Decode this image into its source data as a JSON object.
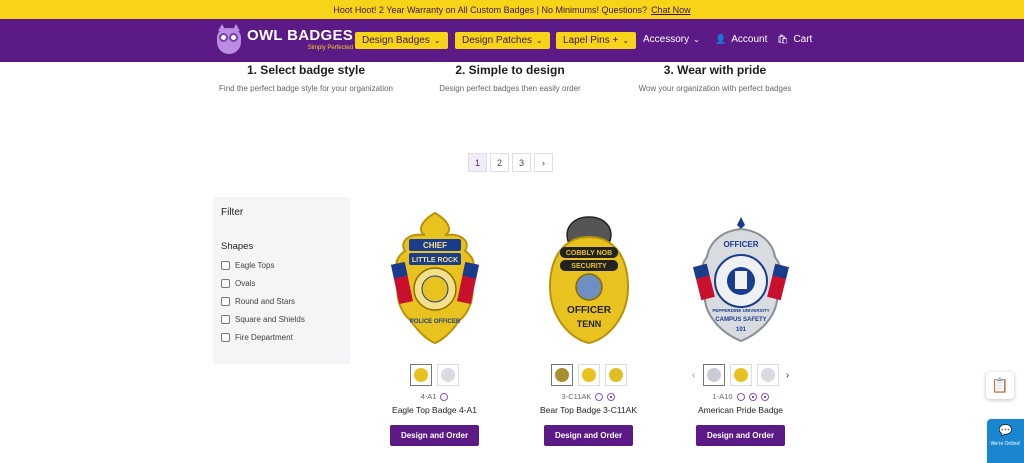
{
  "announcement": {
    "text": "Hoot Hoot! 2 Year Warranty on All Custom Badges | No Minimums!  Questions?",
    "link": "Chat Now"
  },
  "header": {
    "brand": "OWL BADGES",
    "tagline": "Simply Perfected",
    "nav_primary": [
      {
        "label": "Design Badges",
        "icon": "chevron-down-icon"
      },
      {
        "label": "Design Patches",
        "icon": "chevron-down-icon"
      },
      {
        "label": "Lapel Pins +",
        "icon": "chevron-down-icon"
      }
    ],
    "accessory": "Accessory",
    "account": "Account",
    "cart": "Cart"
  },
  "steps": [
    {
      "title": "1. Select badge style",
      "desc": "Find the perfect badge style for your organization"
    },
    {
      "title": "2. Simple to design",
      "desc": "Design perfect badges then easily order"
    },
    {
      "title": "3. Wear with pride",
      "desc": "Wow your organization with perfect badges"
    }
  ],
  "pagination": {
    "pages": [
      "1",
      "2",
      "3"
    ],
    "next": "›",
    "current": "1"
  },
  "filter": {
    "title": "Filter",
    "group": "Shapes",
    "options": [
      "Eagle Tops",
      "Ovals",
      "Round and Stars",
      "Square and Shields",
      "Fire Department"
    ]
  },
  "products": [
    {
      "sku": "4-A1",
      "name": "Eagle Top Badge 4-A1",
      "cta": "Design and Order",
      "badge_text": [
        "CHIEF",
        "LITTLE ROCK",
        "POLICE OFFICER"
      ]
    },
    {
      "sku": "3-C11AK",
      "name": "Bear Top Badge 3-C11AK",
      "cta": "Design and Order",
      "badge_text": [
        "COBBLY NOB",
        "SECURITY",
        "OFFICER",
        "TENN"
      ]
    },
    {
      "sku": "1-A10",
      "name": "American Pride Badge",
      "cta": "Design and Order",
      "badge_text": [
        "OFFICER",
        "PEPPERDINE UNIVERSITY",
        "CAMPUS SAFETY",
        "101"
      ]
    }
  ],
  "chat_widget": {
    "text": "We're Online!"
  },
  "colors": {
    "brand_purple": "#5b1a86",
    "accent_yellow": "#f7d417",
    "gold": "#e8c21e",
    "silver": "#d8dbe0"
  }
}
